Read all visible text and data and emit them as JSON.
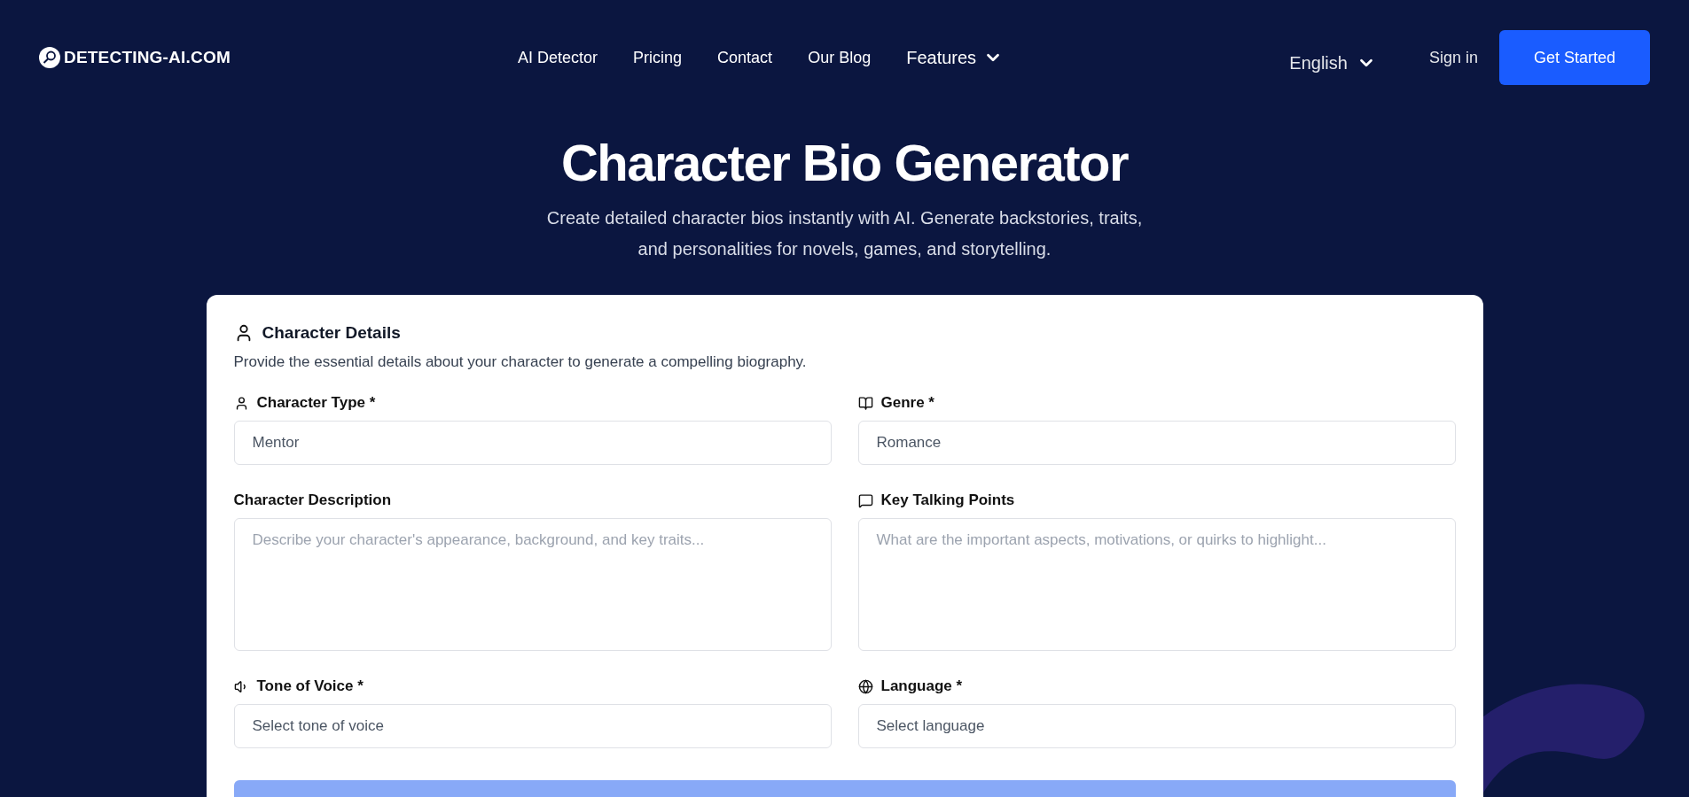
{
  "header": {
    "logo": "DETECTING-AI.COM",
    "nav": [
      {
        "label": "AI Detector",
        "dropdown": false
      },
      {
        "label": "Pricing",
        "dropdown": false
      },
      {
        "label": "Contact",
        "dropdown": false
      },
      {
        "label": "Our Blog",
        "dropdown": false
      },
      {
        "label": "Features",
        "dropdown": true
      }
    ],
    "language": "English",
    "sign_in": "Sign in",
    "cta": "Get Started"
  },
  "hero": {
    "title": "Character Bio Generator",
    "subtitle": [
      "Create detailed character bios instantly with AI. Generate backstories, traits,",
      "and personalities for novels, games, and storytelling."
    ]
  },
  "form": {
    "title": "Character Details",
    "description": "Provide the essential details about your character to generate a compelling biography.",
    "fields": [
      {
        "kind": "select",
        "label": "Character Type *",
        "value": "Mentor"
      },
      {
        "kind": "select",
        "label": "Genre *",
        "value": "Romance"
      },
      {
        "kind": "textarea",
        "label": "Character Description",
        "placeholder": "Describe your character's appearance, background, and key traits..."
      },
      {
        "kind": "textarea",
        "label": "Key Talking Points",
        "placeholder": "What are the important aspects, motivations, or quirks to highlight..."
      },
      {
        "kind": "select",
        "label": "Tone of Voice *",
        "value": "Select tone of voice"
      },
      {
        "kind": "select",
        "label": "Language *",
        "value": "Select language"
      }
    ]
  }
}
